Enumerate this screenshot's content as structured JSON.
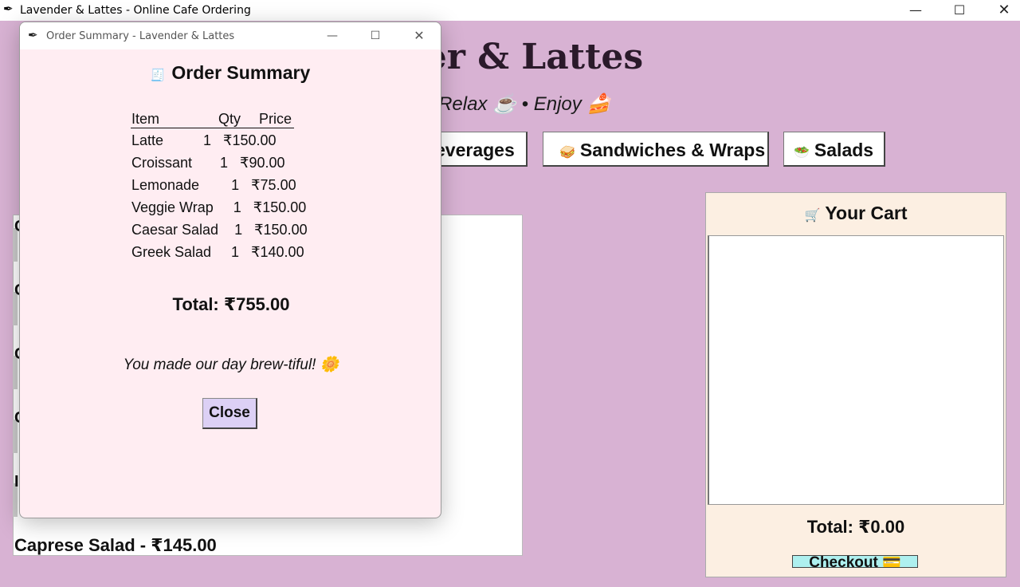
{
  "main_window": {
    "title": "Lavender & Lattes - Online Cafe Ordering",
    "app_icon": "feather-icon",
    "controls": {
      "minimize": "—",
      "maximize": "☐",
      "close": "✕"
    }
  },
  "app": {
    "heading_visible": "nder & Lattes",
    "tagline_visible": "? • Relax ☕ • Enjoy 🍰",
    "categories": [
      {
        "label": "everages",
        "icon": ""
      },
      {
        "label": "Sandwiches & Wraps",
        "icon": "🥪"
      },
      {
        "label": "Salads",
        "icon": "🥗"
      }
    ]
  },
  "menu": {
    "row_initials": [
      "C",
      "C",
      "C",
      "C",
      "I"
    ],
    "last_item": "Caprese Salad - ₹145.00"
  },
  "cart": {
    "title": "Your Cart",
    "icon": "🛒",
    "total": "Total: ₹0.00",
    "checkout_label": "Checkout 💳"
  },
  "dialog": {
    "title": "Order Summary - Lavender & Lattes",
    "heading": "Order Summary",
    "heading_icon": "🧾",
    "columns": {
      "item": "Item",
      "qty": "Qty",
      "price": "Price"
    },
    "rows": [
      "Latte          1   ₹150.00",
      "Croissant       1   ₹90.00",
      "Lemonade        1   ₹75.00",
      "Veggie Wrap     1   ₹150.00",
      "Caesar Salad    1   ₹150.00",
      "Greek Salad     1   ₹140.00"
    ],
    "total": "Total: ₹755.00",
    "message": "You made our day brew-tiful! 🌼",
    "close_label": "Close"
  }
}
